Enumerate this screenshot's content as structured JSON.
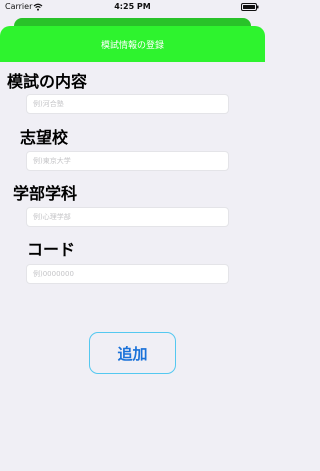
{
  "status_bar": {
    "carrier": "Carrier",
    "time": "4:25 PM"
  },
  "header": {
    "title": "模試情報の登録",
    "color": "#2ef32e"
  },
  "form": {
    "exam_name": {
      "label": "模試の内容",
      "placeholder": "例)河合塾"
    },
    "target_school": {
      "label": "志望校",
      "placeholder": "例)東京大学"
    },
    "faculty": {
      "label": "学部学科",
      "placeholder": "例)心理学部"
    },
    "code": {
      "label": "コード",
      "placeholder": "例)0000000"
    }
  },
  "add_button": {
    "label": "追加",
    "border_color": "#54c8f0",
    "text_color": "#1a72d9"
  },
  "icons": [
    "wifi-icon",
    "battery-icon"
  ]
}
